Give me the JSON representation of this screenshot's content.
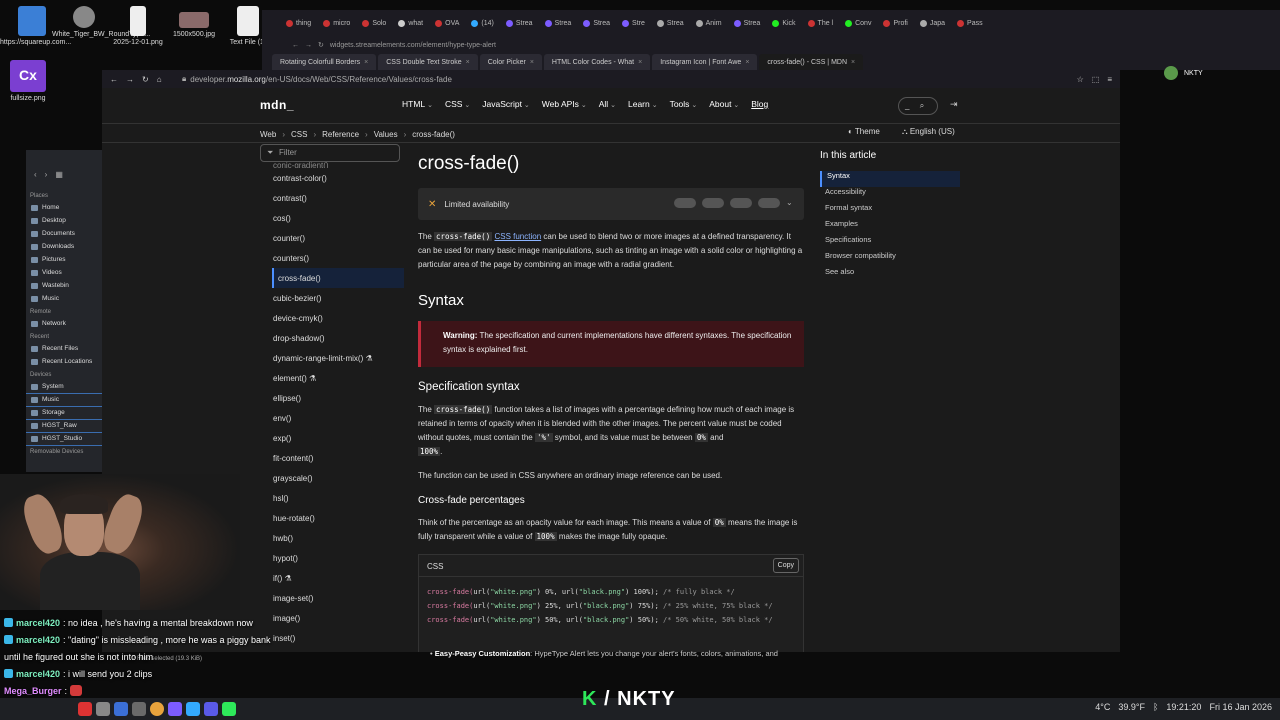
{
  "desktop": {
    "icons": [
      {
        "label": "https://squareup.com..."
      },
      {
        "label": "White_Tiger_BW_RoundType..."
      },
      {
        "label": "2025-12-01.png"
      },
      {
        "label": "1500x500.jpg"
      },
      {
        "label": "Text File (1)"
      },
      {
        "label": "fullsize.png"
      }
    ],
    "user": "NKTY"
  },
  "bg_browser": {
    "url": "widgets.streamelements.com/element/hype-type-alert",
    "tabs": [
      "thing",
      "micro",
      "Solo",
      "what",
      "OVA",
      "(14)",
      "Strea",
      "Strea",
      "Strea",
      "Stre",
      "Strea",
      "Anim",
      "Strea",
      "Kick",
      "The l",
      "Conv",
      "Profi",
      "Japa",
      "Pass"
    ],
    "tabs2": [
      "Rotating Colorfull Borders",
      "CSS Double Text Stroke",
      "Color Picker",
      "HTML Color Codes - What",
      "Instagram Icon | Font Awe",
      "cross-fade() - CSS | MDN"
    ]
  },
  "browser": {
    "url_prefix": "developer.",
    "url_host": "mozilla.org",
    "url_path": "/en-US/docs/Web/CSS/Reference/Values/cross-fade"
  },
  "mdn": {
    "logo": "mdn_",
    "nav": [
      "HTML",
      "CSS",
      "JavaScript",
      "Web APIs",
      "All",
      "Learn",
      "Tools",
      "About",
      "Blog"
    ],
    "search_placeholder": "_",
    "crumbs": [
      "Web",
      "CSS",
      "Reference",
      "Values",
      "cross-fade()"
    ],
    "theme": "Theme",
    "lang": "English (US)",
    "filter_placeholder": "Filter",
    "sidebar": [
      "conic-gradient()",
      "contrast-color()",
      "contrast()",
      "cos()",
      "counter()",
      "counters()",
      "cross-fade()",
      "cubic-bezier()",
      "device-cmyk()",
      "drop-shadow()",
      "dynamic-range-limit-mix() ⚗",
      "element() ⚗",
      "ellipse()",
      "env()",
      "exp()",
      "fit-content()",
      "grayscale()",
      "hsl()",
      "hue-rotate()",
      "hwb()",
      "hypot()",
      "if() ⚗",
      "image-set()",
      "image()",
      "inset()"
    ],
    "title": "cross-fade()",
    "availability": "Limited availability",
    "intro_pre": "The",
    "intro_code": "cross-fade()",
    "intro_link": "CSS function",
    "intro_post": "can be used to blend two or more images at a defined transparency. It can be used for many basic image manipulations, such as tinting an image with a solid color or highlighting a particular area of the page by combining an image with a radial gradient.",
    "h_syntax": "Syntax",
    "warning_label": "Warning:",
    "warning_text": "The specification and current implementations have different syntaxes. The specification syntax is explained first.",
    "h_spec": "Specification syntax",
    "spec_pre": "The",
    "spec_code": "cross-fade()",
    "spec_post1": "function takes a list of images with a percentage defining how much of each image is retained in terms of opacity when it is blended with the other images. The percent value must be coded without quotes, must contain the",
    "spec_code2": "'%'",
    "spec_post2": "symbol, and its value must be between",
    "spec_zero": "0%",
    "spec_and": "and",
    "spec_hundred": "100%",
    "spec_end": ".",
    "anywhere": "The function can be used in CSS anywhere an ordinary image reference can be used.",
    "h_percent": "Cross-fade percentages",
    "percent_text1": "Think of the percentage as an opacity value for each image. This means a value of",
    "percent_zero": "0%",
    "percent_text2": "means the image is fully transparent while a value of",
    "percent_hundred": "100%",
    "percent_text3": "makes the image fully opaque.",
    "code_lang": "CSS",
    "copy": "Copy",
    "code_lines": [
      {
        "fn": "cross-fade(",
        "a": "url(",
        "s1": "\"white.png\"",
        "b": ") 0%, url(",
        "s2": "\"black.png\"",
        "c": ") 100%);",
        "cm": " /* fully black */"
      },
      {
        "fn": "cross-fade(",
        "a": "url(",
        "s1": "\"white.png\"",
        "b": ") 25%, url(",
        "s2": "\"black.png\"",
        "c": ") 75%);",
        "cm": " /* 25% white, 75% black */"
      },
      {
        "fn": "cross-fade(",
        "a": "url(",
        "s1": "\"white.png\"",
        "b": ") 50%, url(",
        "s2": "\"black.png\"",
        "c": ") 50%);",
        "cm": " /* 50% white, 50% black */"
      }
    ],
    "toc_title": "In this article",
    "toc": [
      "Syntax",
      "Accessibility",
      "Formal syntax",
      "Examples",
      "Specifications",
      "Browser compatibility",
      "See also"
    ]
  },
  "file_manager": {
    "groups": [
      {
        "name": "Places",
        "items": [
          "Home",
          "Desktop",
          "Documents",
          "Downloads",
          "Pictures",
          "Videos",
          "Wastebin",
          "Music"
        ]
      },
      {
        "name": "Remote",
        "items": [
          "Network"
        ]
      },
      {
        "name": "Recent",
        "items": [
          "Recent Files",
          "Recent Locations"
        ]
      },
      {
        "name": "Devices",
        "items": [
          "System",
          "Music",
          "Storage",
          "HGST_Raw",
          "HGST_Studio"
        ]
      },
      {
        "name": "Removable Devices",
        "items": []
      }
    ],
    "status": "2 Files selected (19.3 KiB)"
  },
  "ext_line": {
    "bold": "Easy-Peasy Customization",
    "text": ": HypeType Alert lets you change your alert's fonts, colors, animations, and"
  },
  "chat": [
    {
      "user": "marcel420",
      "text": ": no idea , he's having a mental breakdown now"
    },
    {
      "user": "marcel420",
      "text": ": \"dating\" is missleading , more he was a piggy bank"
    },
    {
      "user": "",
      "text": "until he figured out she is not into him"
    },
    {
      "user": "marcel420",
      "text": ": i will send you 2 clips"
    },
    {
      "user": "Mega_Burger",
      "text": ":"
    },
    {
      "user": "marcel420",
      "text": ":"
    }
  ],
  "overlay": {
    "k": "K",
    "slash": " / ",
    "name": "NKTY"
  },
  "tray": {
    "weather": "4°C",
    "cpu": "39.9°F",
    "time": "19:21:20",
    "date": "Fri 16 Jan 2026"
  }
}
